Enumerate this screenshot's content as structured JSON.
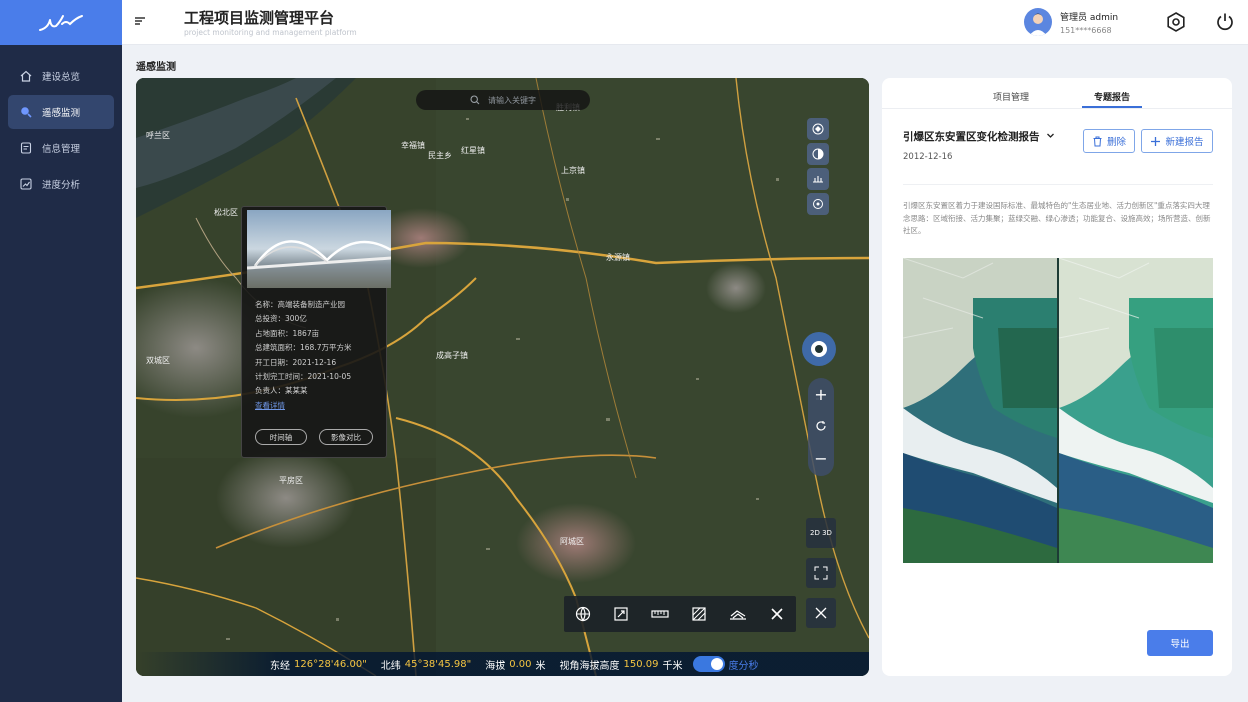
{
  "app": {
    "title": "工程项目监测管理平台",
    "subtitle": "project monitoring and management platform"
  },
  "user": {
    "name": "管理员 admin",
    "phone": "151****6668"
  },
  "sidebar": {
    "items": [
      {
        "label": "建设总览",
        "icon": "home-icon"
      },
      {
        "label": "遥感监测",
        "icon": "search-icon",
        "active": true
      },
      {
        "label": "信息管理",
        "icon": "document-icon"
      },
      {
        "label": "进度分析",
        "icon": "chart-icon"
      }
    ]
  },
  "page": {
    "title": "遥感监测"
  },
  "map": {
    "search_placeholder": "请输入关键字",
    "place_labels": [
      "呼兰区",
      "松北区",
      "平房区",
      "阿城区",
      "永源镇",
      "胜利镇",
      "民主乡",
      "红星镇",
      "上京镇",
      "成高子镇",
      "幸福镇",
      "双城区"
    ],
    "info_card": {
      "name": "名称：高端装备制造产业园",
      "investment": "总投资：300亿",
      "area": "占地面积：1867亩",
      "building_area": "总建筑面积：168.7万平方米",
      "start_date": "开工日期：2021-12-16",
      "plan_date": "计划完工时间：2021-10-05",
      "owner": "负责人：某某某",
      "detail_link": "查看详情",
      "btn_timeline": "时间轴",
      "btn_compare": "影像对比"
    },
    "toggle_3d": "2D 3D",
    "status": {
      "lon_label": "东经",
      "lon_value": "126°28'46.00\"",
      "lat_label": "北纬",
      "lat_value": "45°38'45.98\"",
      "alt_label": "海拔",
      "alt_value": "0.00",
      "alt_unit": "米",
      "view_label": "视角海拔高度",
      "view_value": "150.09",
      "view_unit": "千米",
      "toggle_label": "度分秒"
    }
  },
  "panel": {
    "tabs": [
      "项目管理",
      "专题报告"
    ],
    "active_tab": "专题报告",
    "report_title": "引爆区东安置区变化检测报告",
    "report_date": "2012-12-16",
    "delete_btn": "删除",
    "new_btn": "新建报告",
    "description": "引爆区东安置区着力于建设国际标准、最城特色的\"生态居业地、活力创新区\"重点落实四大理念思路：区域衔接、活力集聚；蓝绿交融、绿心渗透；功能复合、设施高效；场所营造、创新社区。",
    "export_btn": "导出"
  },
  "colors": {
    "accent": "#4a7dea",
    "sidebar_bg": "#1f2b47",
    "status_yellow": "#f4c542"
  }
}
